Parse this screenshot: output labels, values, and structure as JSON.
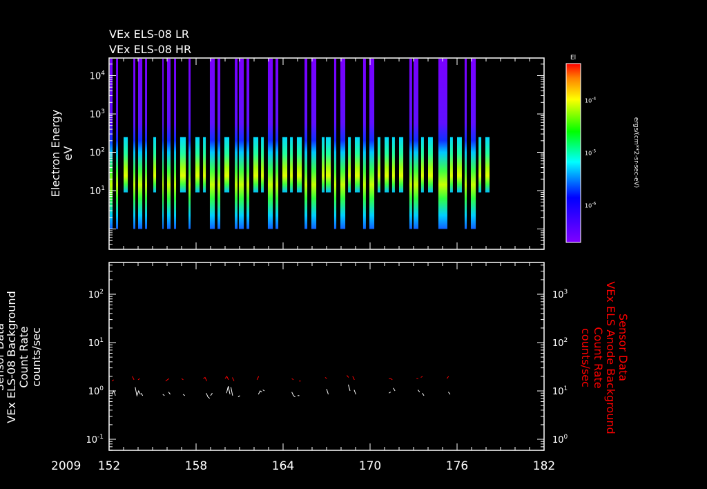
{
  "chart_data": [
    {
      "type": "heatmap",
      "titles": [
        "VEx ELS-08 LR",
        "VEx ELS-08 HR"
      ],
      "ylabel": [
        "Electron Energy",
        "eV"
      ],
      "yscale": "log",
      "ylim": [
        0.3,
        30000
      ],
      "yticks": [
        {
          "v": 10,
          "label": "10",
          "exp": "1"
        },
        {
          "v": 100,
          "label": "10",
          "exp": "2"
        },
        {
          "v": 1000,
          "label": "10",
          "exp": "3"
        },
        {
          "v": 10000,
          "label": "10",
          "exp": "4"
        }
      ],
      "xlim": [
        152,
        182
      ],
      "colorbar": {
        "title": "El",
        "label": "ergs/(cm**2-sr-sec-eV)",
        "scale": "log",
        "range": [
          2e-07,
          0.0005
        ],
        "ticks": [
          {
            "v": 0.0001,
            "label": "10",
            "exp": "-4"
          },
          {
            "v": 1e-05,
            "label": "10",
            "exp": "-5"
          },
          {
            "v": 1e-06,
            "label": "10",
            "exp": "-6"
          }
        ]
      },
      "lr_energy_range": [
        1,
        30000
      ],
      "hr_energy_range": [
        9,
        250
      ],
      "lr_passes": [
        [
          152.05,
          152.24
        ],
        [
          152.48,
          152.62
        ],
        [
          153.67,
          153.81
        ],
        [
          154.0,
          154.29
        ],
        [
          154.48,
          154.62
        ],
        [
          155.67,
          155.76
        ],
        [
          156.0,
          156.24
        ],
        [
          156.48,
          156.62
        ],
        [
          157.48,
          157.62
        ],
        [
          158.95,
          159.29
        ],
        [
          159.48,
          159.67
        ],
        [
          160.67,
          160.86
        ],
        [
          160.95,
          161.29
        ],
        [
          161.48,
          161.67
        ],
        [
          162.95,
          163.29
        ],
        [
          163.48,
          163.67
        ],
        [
          165.48,
          165.67
        ],
        [
          165.95,
          166.29
        ],
        [
          167.52,
          167.67
        ],
        [
          167.95,
          168.29
        ],
        [
          169.52,
          169.71
        ],
        [
          169.95,
          170.29
        ],
        [
          172.71,
          172.9
        ],
        [
          173.0,
          173.33
        ],
        [
          174.71,
          175.33
        ],
        [
          176.52,
          176.67
        ],
        [
          176.95,
          177.29
        ]
      ],
      "hr_passes": [
        [
          153.0,
          153.29
        ],
        [
          155.05,
          155.24
        ],
        [
          156.9,
          157.29
        ],
        [
          157.95,
          158.24
        ],
        [
          158.48,
          158.67
        ],
        [
          159.95,
          160.29
        ],
        [
          161.95,
          162.29
        ],
        [
          162.48,
          162.67
        ],
        [
          163.95,
          164.29
        ],
        [
          164.48,
          164.67
        ],
        [
          164.95,
          165.29
        ],
        [
          166.67,
          166.86
        ],
        [
          166.95,
          167.29
        ],
        [
          168.48,
          168.67
        ],
        [
          168.95,
          169.29
        ],
        [
          170.52,
          170.71
        ],
        [
          171.0,
          171.29
        ],
        [
          171.52,
          171.71
        ],
        [
          172.0,
          172.29
        ],
        [
          173.52,
          173.71
        ],
        [
          174.0,
          174.33
        ],
        [
          175.52,
          175.71
        ],
        [
          176.0,
          176.33
        ],
        [
          177.48,
          177.67
        ],
        [
          177.95,
          178.24
        ]
      ]
    },
    {
      "type": "line",
      "ylabel_left": [
        "Sensor Data",
        "VEx ELS-08 Background",
        "Count Rate",
        "counts/sec"
      ],
      "ylabel_right": [
        "Sensor Data",
        "VEx ELS Anode Background",
        "Count Rate",
        "counts/sec"
      ],
      "yscale": "log",
      "ylim_left": [
        0.05,
        500
      ],
      "ylim_right": [
        0.5,
        5000
      ],
      "yticks_left": [
        {
          "v": 0.1,
          "label": "10",
          "exp": "-1"
        },
        {
          "v": 1,
          "label": "10",
          "exp": "0"
        },
        {
          "v": 10,
          "label": "10",
          "exp": "1"
        },
        {
          "v": 100,
          "label": "10",
          "exp": "2"
        }
      ],
      "yticks_right": [
        {
          "v": 1,
          "label": "10",
          "exp": "0"
        },
        {
          "v": 10,
          "label": "10",
          "exp": "1"
        },
        {
          "v": 100,
          "label": "10",
          "exp": "2"
        },
        {
          "v": 1000,
          "label": "10",
          "exp": "3"
        }
      ],
      "series": [
        {
          "name": "VEx ELS-08 Background",
          "color": "#ffffff",
          "axis": "left",
          "clusters": [
            [
              152.2,
              [
                0.85,
                1.0,
                0.8
              ]
            ],
            [
              153.8,
              [
                1.2,
                0.8,
                1.0,
                0.85
              ]
            ],
            [
              154.2,
              [
                0.9,
                0.8
              ]
            ],
            [
              155.7,
              [
                0.85,
                0.8
              ]
            ],
            [
              156.1,
              [
                0.95,
                0.85
              ]
            ],
            [
              157.1,
              [
                0.85,
                0.8
              ]
            ],
            [
              158.7,
              [
                0.9,
                0.75,
                0.7
              ]
            ],
            [
              159.0,
              [
                0.8,
                0.9
              ]
            ],
            [
              160.1,
              [
                0.9,
                1.25,
                0.85
              ]
            ],
            [
              160.4,
              [
                1.2,
                0.8
              ]
            ],
            [
              160.9,
              [
                0.75,
                0.8
              ]
            ],
            [
              162.3,
              [
                0.85,
                1.0,
                0.95
              ]
            ],
            [
              162.6,
              [
                1.05,
                1.0
              ]
            ],
            [
              164.6,
              [
                0.95,
                0.8,
                0.75
              ]
            ],
            [
              165.0,
              [
                0.8,
                0.8
              ]
            ],
            [
              166.6,
              [
                0.85
              ]
            ],
            [
              167.0,
              [
                1.1,
                0.85
              ]
            ],
            [
              168.5,
              [
                1.35,
                1.0
              ]
            ],
            [
              168.9,
              [
                1.05,
                0.85
              ]
            ],
            [
              171.3,
              [
                0.9,
                0.95
              ]
            ],
            [
              171.6,
              [
                1.15,
                1.0
              ]
            ],
            [
              173.3,
              [
                1.05,
                0.95
              ]
            ],
            [
              173.6,
              [
                0.9,
                0.8
              ]
            ],
            [
              174.9,
              [
                0.7
              ]
            ],
            [
              175.4,
              [
                0.95,
                0.85
              ]
            ]
          ]
        },
        {
          "name": "VEx ELS Anode Background",
          "color": "#ff0000",
          "axis": "right",
          "clusters": [
            [
              152.2,
              [
                16,
                17
              ]
            ],
            [
              153.6,
              [
                20,
                17
              ]
            ],
            [
              154.0,
              [
                17,
                18
              ]
            ],
            [
              155.5,
              [
                16
              ]
            ],
            [
              155.9,
              [
                16,
                17,
                18
              ]
            ],
            [
              157.0,
              [
                18,
                17
              ]
            ],
            [
              158.5,
              [
                18,
                19,
                16
              ]
            ],
            [
              160.0,
              [
                18,
                20,
                17
              ]
            ],
            [
              160.5,
              [
                19,
                16
              ]
            ],
            [
              162.2,
              [
                17,
                20
              ]
            ],
            [
              162.6,
              [
                20
              ]
            ],
            [
              164.6,
              [
                18,
                17
              ]
            ],
            [
              165.1,
              [
                16,
                16
              ]
            ],
            [
              166.5,
              [
                17
              ]
            ],
            [
              166.9,
              [
                19,
                18
              ]
            ],
            [
              168.4,
              [
                21,
                19
              ]
            ],
            [
              168.8,
              [
                20,
                17
              ]
            ],
            [
              171.3,
              [
                18,
                18,
                17
              ]
            ],
            [
              173.2,
              [
                18,
                18
              ]
            ],
            [
              173.5,
              [
                19,
                20
              ]
            ],
            [
              174.9,
              [
                16
              ]
            ],
            [
              175.3,
              [
                18,
                20
              ]
            ]
          ]
        }
      ]
    }
  ],
  "xaxis": {
    "year": "2009",
    "ticks": [
      "152",
      "158",
      "164",
      "170",
      "176",
      "182"
    ]
  }
}
